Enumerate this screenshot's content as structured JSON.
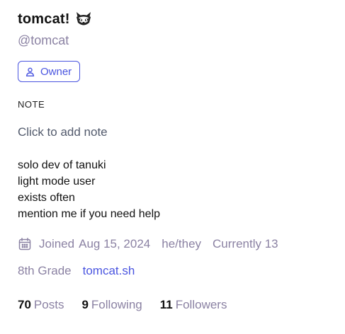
{
  "profile": {
    "display_name": "tomcat!",
    "handle": "@tomcat",
    "name_emoji_icon": "raccoon-emoji-icon"
  },
  "role_badge": {
    "label": "Owner",
    "icon": "user-icon",
    "color": "#4a55e0"
  },
  "note": {
    "heading": "NOTE",
    "placeholder": "Click to add note"
  },
  "bio": {
    "lines": [
      "solo dev of tanuki",
      "light mode user",
      "exists often",
      "mention me if you need help"
    ]
  },
  "meta": {
    "calendar_icon": "calendar-icon",
    "joined_label": "Joined",
    "joined_date": "Aug 15, 2024",
    "pronouns": "he/they",
    "status": "Currently 13",
    "grade": "8th Grade",
    "website": "tomcat.sh"
  },
  "stats": {
    "posts": {
      "count": "70",
      "label": "Posts"
    },
    "following": {
      "count": "9",
      "label": "Following"
    },
    "followers": {
      "count": "11",
      "label": "Followers"
    }
  },
  "colors": {
    "accent": "#4a55e0",
    "muted": "#8b82a3",
    "text": "#111111"
  }
}
